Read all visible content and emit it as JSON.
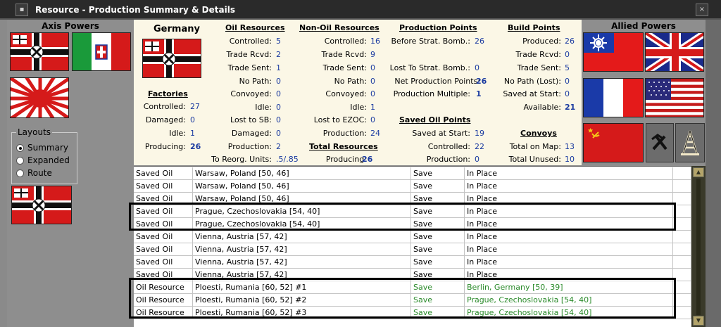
{
  "window": {
    "title": "Resource - Production Summary & Details"
  },
  "axis": {
    "heading": "Axis Powers"
  },
  "allied": {
    "heading": "Allied Powers"
  },
  "layouts": {
    "title": "Layouts",
    "options": [
      "Summary",
      "Expanded",
      "Route"
    ],
    "selected": "Summary"
  },
  "country": {
    "name": "Germany"
  },
  "factories": {
    "heading": "Factories",
    "rows": [
      {
        "label": "Controlled:",
        "value": "27"
      },
      {
        "label": "Damaged:",
        "value": "0"
      },
      {
        "label": "Idle:",
        "value": "1"
      },
      {
        "label": "Producing:",
        "value": "26"
      }
    ]
  },
  "oil_resources": {
    "heading": "Oil Resources",
    "rows": [
      {
        "label": "Controlled:",
        "value": "5"
      },
      {
        "label": "Trade Rcvd:",
        "value": "2"
      },
      {
        "label": "Trade Sent:",
        "value": "1"
      },
      {
        "label": "No Path:",
        "value": "0"
      },
      {
        "label": "Convoyed:",
        "value": "0"
      },
      {
        "label": "Idle:",
        "value": "0"
      },
      {
        "label": "Lost to SB:",
        "value": "0"
      },
      {
        "label": "Damaged:",
        "value": "0"
      },
      {
        "label": "Production:",
        "value": "2"
      },
      {
        "label": "To Reorg. Units:",
        "value": ".5/.85"
      }
    ]
  },
  "non_oil_resources": {
    "heading": "Non-Oil Resources",
    "rows": [
      {
        "label": "Controlled:",
        "value": "16"
      },
      {
        "label": "Trade Rcvd:",
        "value": "9"
      },
      {
        "label": "Trade Sent:",
        "value": "0"
      },
      {
        "label": "No Path:",
        "value": "0"
      },
      {
        "label": "Convoyed:",
        "value": "0"
      },
      {
        "label": "Idle:",
        "value": "1"
      },
      {
        "label": "Lost to EZOC:",
        "value": "0"
      },
      {
        "label": "Production:",
        "value": "24"
      }
    ]
  },
  "total_resources": {
    "heading": "Total Resources",
    "rows": [
      {
        "label": "Producing:",
        "value": "26"
      }
    ]
  },
  "production_points": {
    "heading": "Production Points",
    "rows": [
      {
        "label": "Before Strat. Bomb.:",
        "value": "26"
      },
      {
        "label": "Lost To Strat. Bomb.:",
        "value": "0"
      },
      {
        "label": "Net Production Points:",
        "value": "26"
      },
      {
        "label": "Production Multiple:",
        "value": "1"
      }
    ]
  },
  "saved_oil_points": {
    "heading": "Saved Oil Points",
    "rows": [
      {
        "label": "Saved at Start:",
        "value": "19"
      },
      {
        "label": "Controlled:",
        "value": "22"
      },
      {
        "label": "Production:",
        "value": "0"
      }
    ]
  },
  "build_points": {
    "heading": "Build Points",
    "rows": [
      {
        "label": "Produced:",
        "value": "26"
      },
      {
        "label": "Trade Rcvd:",
        "value": "0"
      },
      {
        "label": "Trade Sent:",
        "value": "5"
      },
      {
        "label": "No Path (Lost):",
        "value": "0"
      },
      {
        "label": "Saved at Start:",
        "value": "0"
      },
      {
        "label": "Available:",
        "value": "21"
      }
    ]
  },
  "convoys": {
    "heading": "Convoys",
    "rows": [
      {
        "label": "Total on Map:",
        "value": "13"
      },
      {
        "label": "Total Unused:",
        "value": "10"
      }
    ]
  },
  "detail_rows": [
    {
      "type": "Saved Oil",
      "location": "Warsaw, Poland [50, 46]",
      "action": "Save",
      "destination": "In Place",
      "green": false
    },
    {
      "type": "Saved Oil",
      "location": "Warsaw, Poland [50, 46]",
      "action": "Save",
      "destination": "In Place",
      "green": false
    },
    {
      "type": "Saved Oil",
      "location": "Warsaw, Poland [50, 46]",
      "action": "Save",
      "destination": "In Place",
      "green": false
    },
    {
      "type": "Saved Oil",
      "location": "Prague, Czechoslovakia [54, 40]",
      "action": "Save",
      "destination": "In Place",
      "green": false
    },
    {
      "type": "Saved Oil",
      "location": "Prague, Czechoslovakia [54, 40]",
      "action": "Save",
      "destination": "In Place",
      "green": false
    },
    {
      "type": "Saved Oil",
      "location": "Vienna, Austria [57, 42]",
      "action": "Save",
      "destination": "In Place",
      "green": false
    },
    {
      "type": "Saved Oil",
      "location": "Vienna, Austria [57, 42]",
      "action": "Save",
      "destination": "In Place",
      "green": false
    },
    {
      "type": "Saved Oil",
      "location": "Vienna, Austria [57, 42]",
      "action": "Save",
      "destination": "In Place",
      "green": false
    },
    {
      "type": "Saved Oil",
      "location": "Vienna, Austria [57, 42]",
      "action": "Save",
      "destination": "In Place",
      "green": false
    },
    {
      "type": "Oil Resource",
      "location": "Ploesti, Rumania [60, 52] #1",
      "action": "Save",
      "destination": "Berlin, Germany [50, 39]",
      "green": true
    },
    {
      "type": "Oil Resource",
      "location": "Ploesti, Rumania [60, 52] #2",
      "action": "Save",
      "destination": "Prague, Czechoslovakia [54, 40]",
      "green": true
    },
    {
      "type": "Oil Resource",
      "location": "Ploesti, Rumania [60, 52] #3",
      "action": "Save",
      "destination": "Prague, Czechoslovakia [54, 40]",
      "green": true
    }
  ],
  "colors": {
    "summary_bg": "#fbf7e6",
    "value_blue": "#1a3aa0",
    "route_green": "#2a8a2a"
  }
}
